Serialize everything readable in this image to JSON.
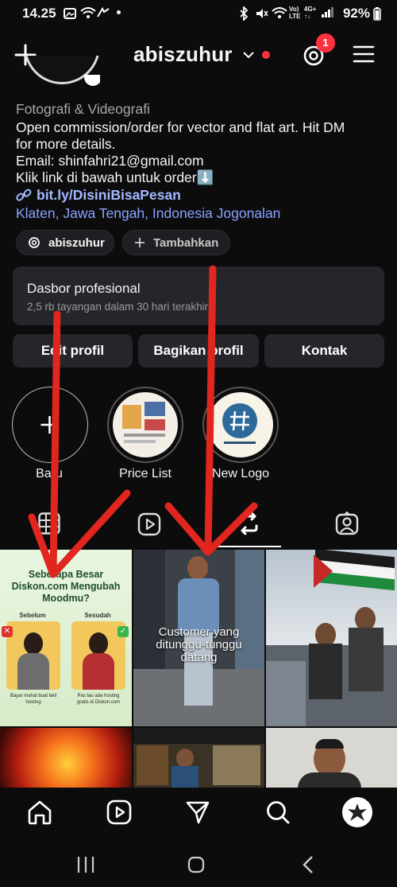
{
  "status_bar": {
    "time": "14.25",
    "battery": "92%"
  },
  "header": {
    "username": "abiszuhur",
    "threads_badge": "1"
  },
  "bio": {
    "category": "Fotografi & Videografi",
    "line1": "Open commission/order for vector and flat art. Hit DM",
    "line2": "for more details.",
    "line3": "Email: shinfahri21@gmail.com",
    "line4": "Klik link di bawah untuk order⬇️",
    "link": "bit.ly/DisiniBisaPesan",
    "location": "Klaten, Jawa Tengah, Indonesia Jogonalan"
  },
  "chips": {
    "threads_label": "abiszuhur",
    "add_label": "Tambahkan"
  },
  "dashboard": {
    "title": "Dasbor profesional",
    "subtitle": "2,5 rb tayangan dalam 30 hari terakhir."
  },
  "buttons": {
    "edit": "Edit profil",
    "share": "Bagikan profil",
    "contact": "Kontak"
  },
  "highlights": [
    {
      "label": "Baru"
    },
    {
      "label": "Price List"
    },
    {
      "label": "New Logo"
    }
  ],
  "grid": {
    "post1": {
      "title": "Seberapa Besar Diskon.com Mengubah Moodmu?",
      "before": "Sebelum",
      "after": "Sesudah",
      "cap1": "Bayar mahal buat beli hosting",
      "cap2": "Pas tau ada hosting gratis di Diskon.com"
    },
    "post2": {
      "caption": "Customer yang ditunggu-tunggu datang"
    }
  },
  "colors": {
    "accent_red": "#ff3040",
    "link": "#a3b8ff",
    "arrow": "#e0261f"
  }
}
